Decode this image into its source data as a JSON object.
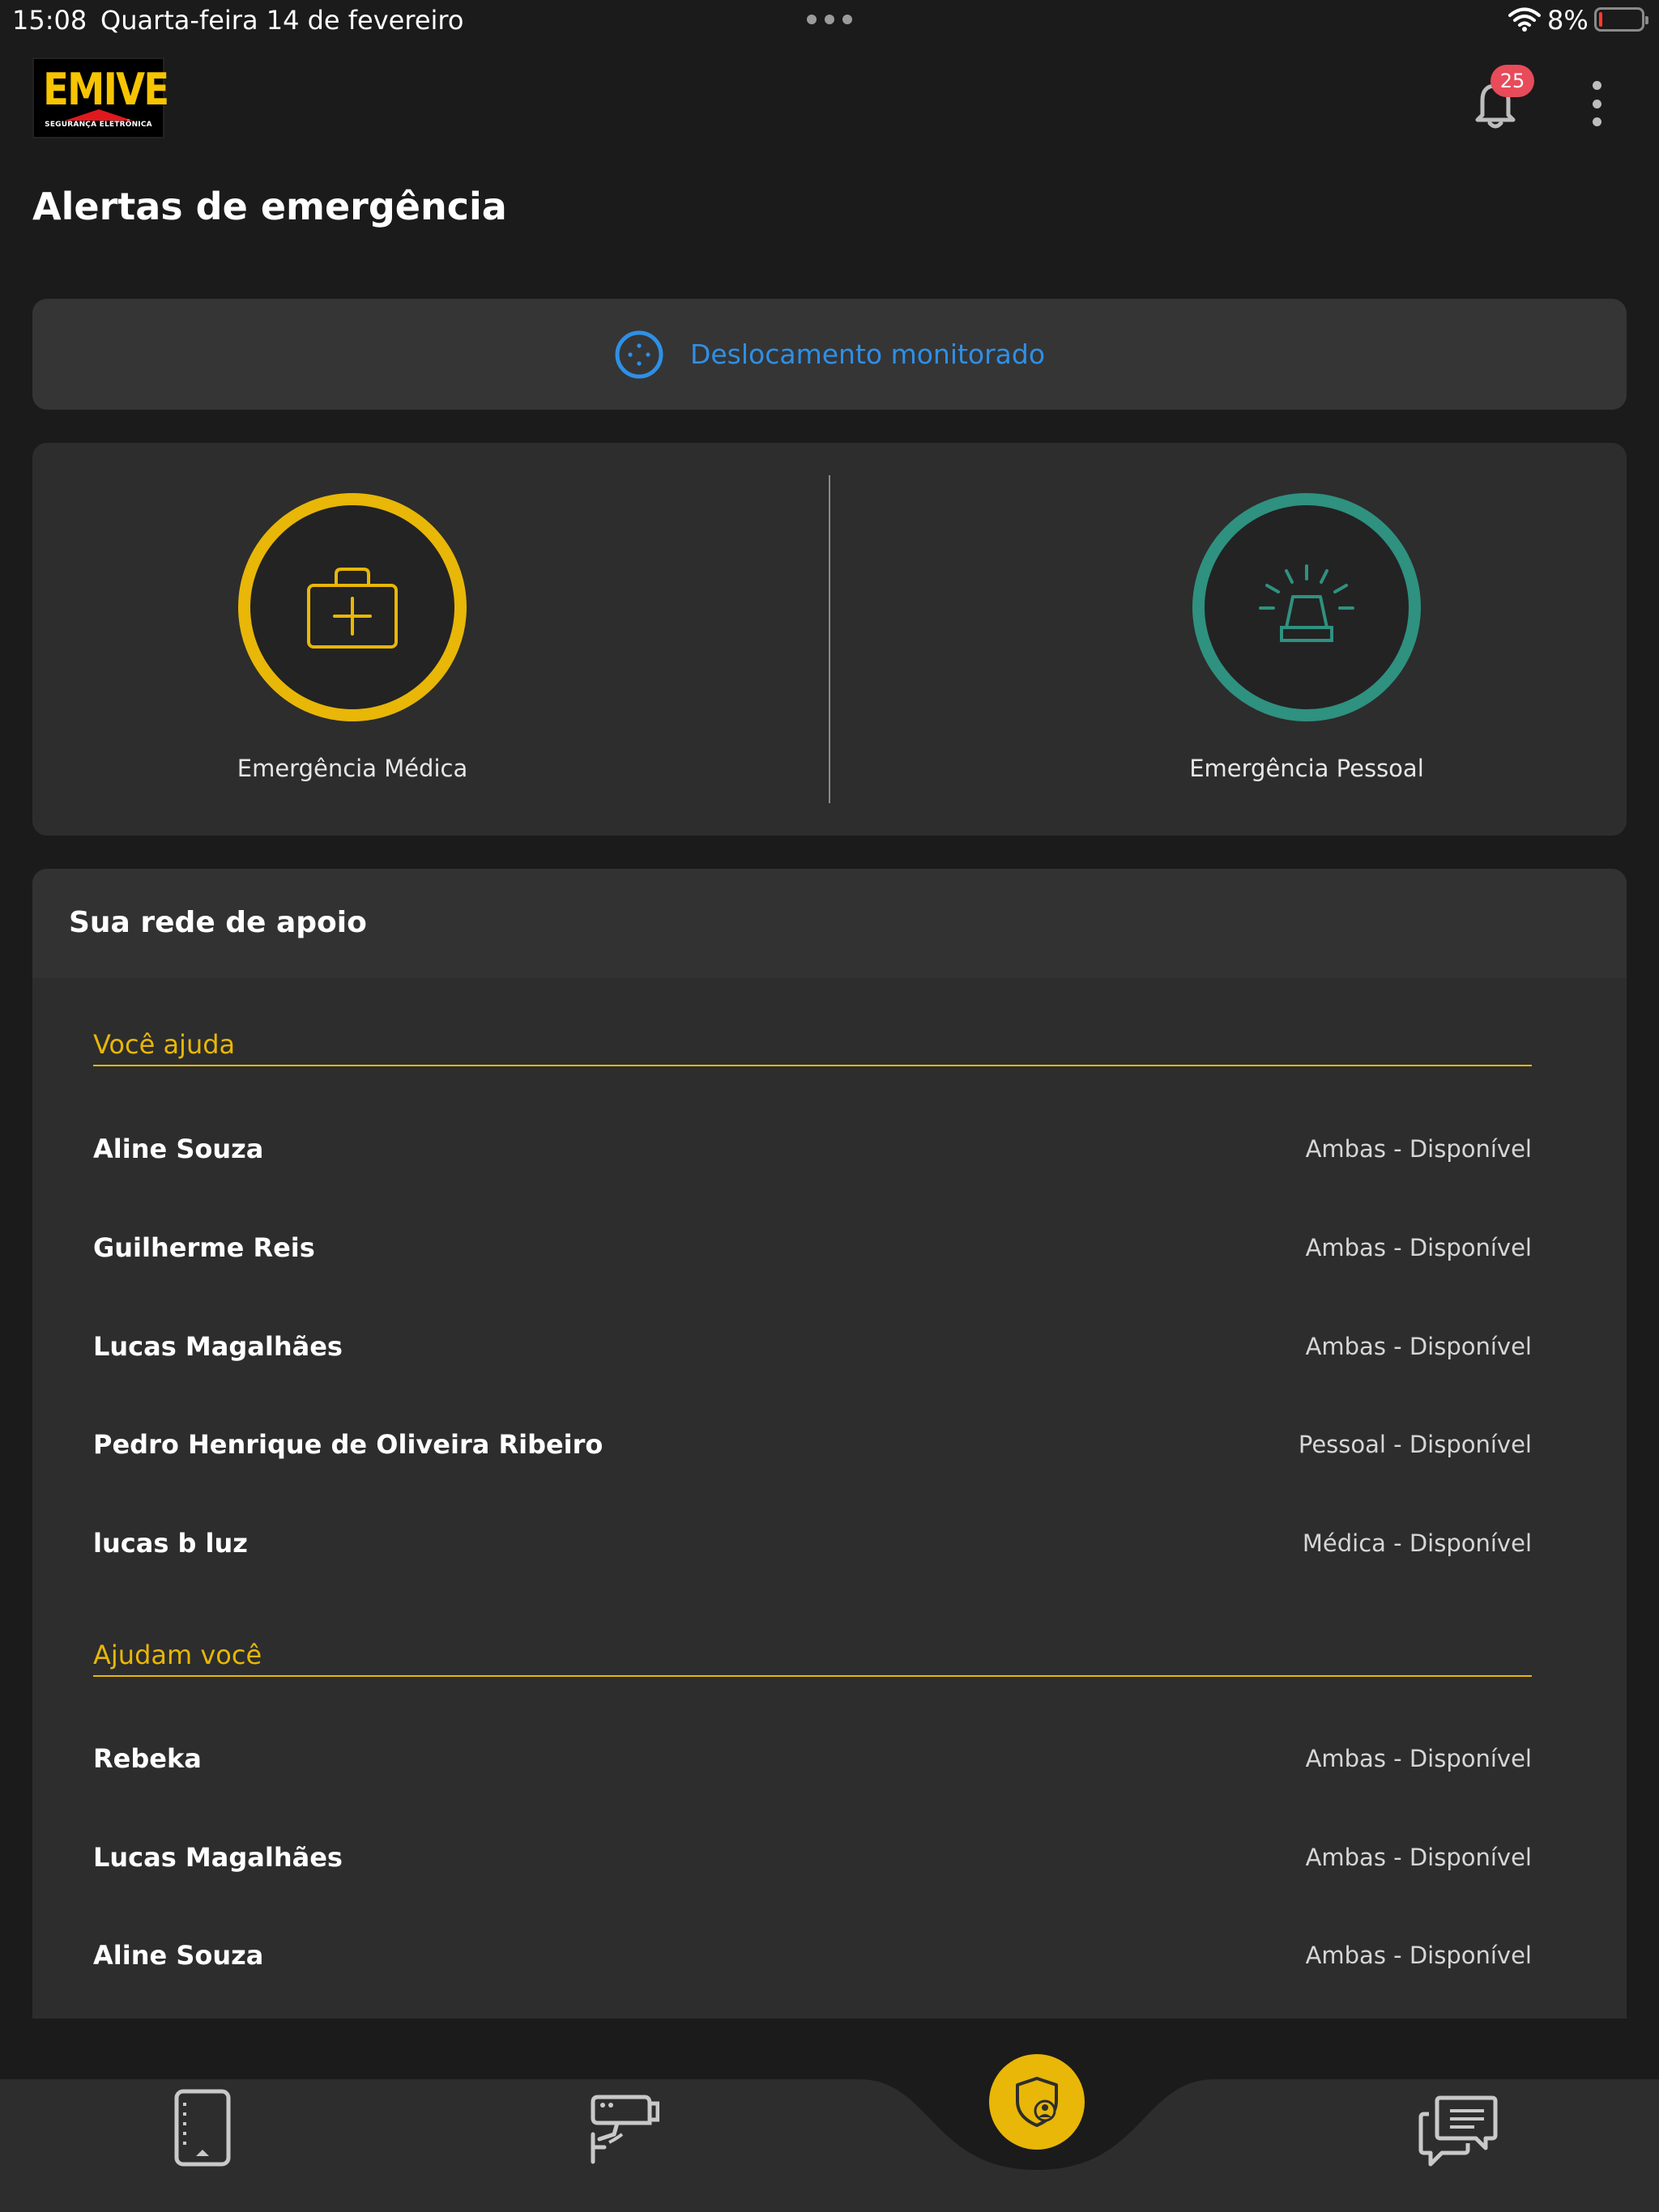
{
  "status_bar": {
    "time": "15:08",
    "date": "Quarta-feira 14 de fevereiro",
    "battery": "8%",
    "battery_level": 0.08
  },
  "header": {
    "logo_text": "EMIVE",
    "logo_subtitle": "SEGURANÇA ELETRÔNICA",
    "notification_count": "25"
  },
  "page_title": "Alertas de emergência",
  "monitored": {
    "label": "Deslocamento monitorado"
  },
  "emergency": {
    "medical_label": "Emergência Médica",
    "personal_label": "Emergência Pessoal"
  },
  "support": {
    "title": "Sua rede de apoio",
    "you_help": {
      "title": "Você ajuda",
      "rows": [
        {
          "name": "Aline Souza",
          "status": "Ambas - Disponível"
        },
        {
          "name": "Guilherme Reis",
          "status": "Ambas - Disponível"
        },
        {
          "name": "Lucas Magalhães",
          "status": "Ambas - Disponível"
        },
        {
          "name": "Pedro Henrique de Oliveira Ribeiro",
          "status": "Pessoal - Disponível"
        },
        {
          "name": "lucas b luz",
          "status": "Médica - Disponível"
        }
      ]
    },
    "help_you": {
      "title": "Ajudam você",
      "rows": [
        {
          "name": "Rebeka",
          "status": "Ambas - Disponível"
        },
        {
          "name": "Lucas Magalhães",
          "status": "Ambas - Disponível"
        },
        {
          "name": "Aline Souza",
          "status": "Ambas - Disponível"
        }
      ]
    }
  },
  "colors": {
    "accent_yellow": "#e8b707",
    "accent_teal": "#2f9180",
    "accent_blue": "#2f8fe6",
    "badge_red": "#e84b5a"
  },
  "tabbar": {
    "icons": [
      "tablet-icon",
      "security-camera-icon",
      "shield-user-icon",
      "chat-icon"
    ]
  }
}
